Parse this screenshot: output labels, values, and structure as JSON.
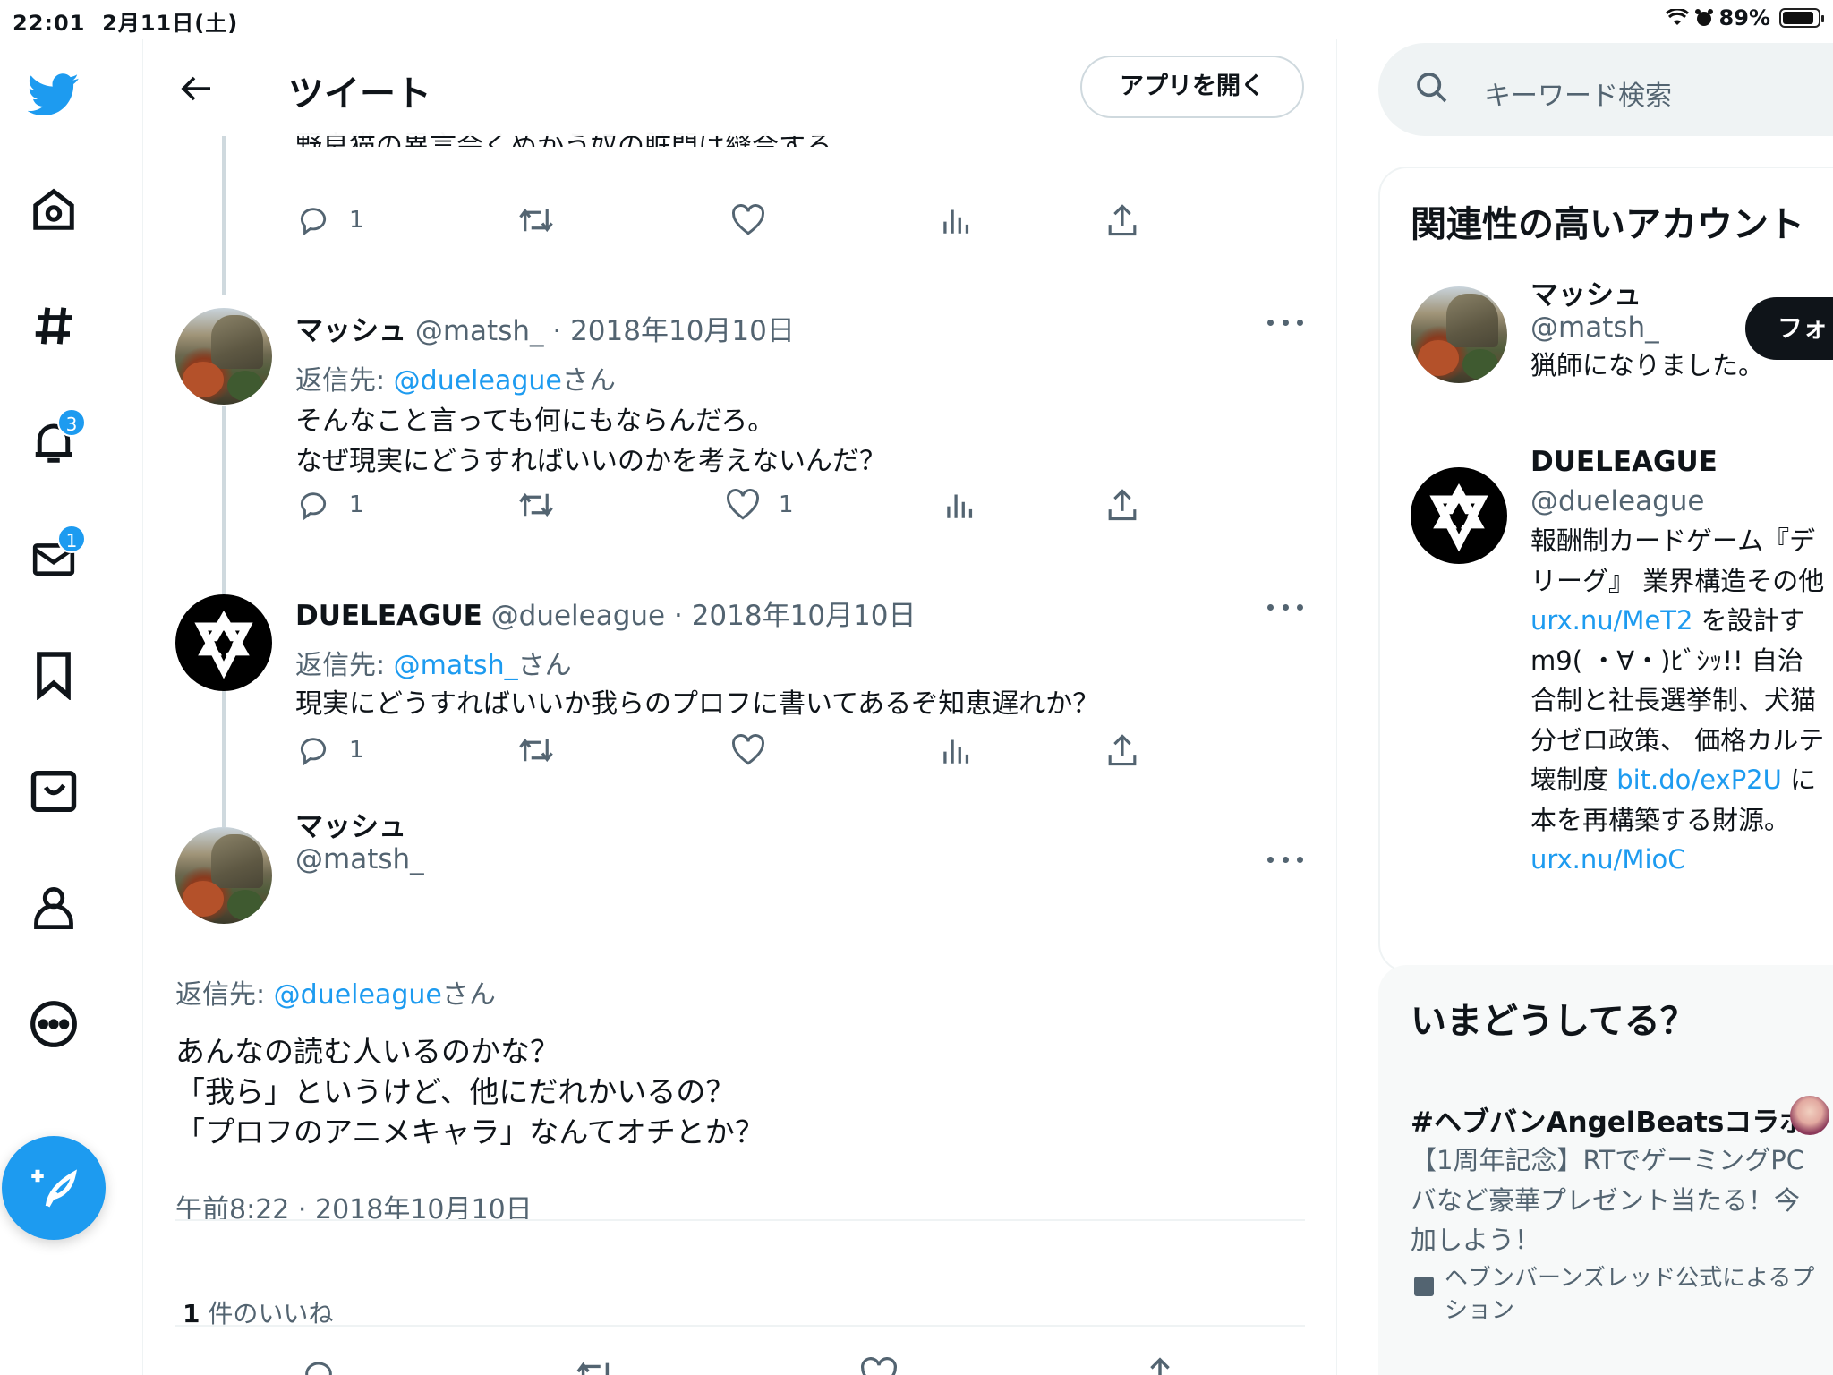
{
  "status_bar": {
    "time": "22:01",
    "date": "2月11日(土)",
    "battery_pct": "89%",
    "battery_level": 0.89
  },
  "header": {
    "title": "ツイート",
    "open_app_label": "アプリを開く"
  },
  "nav": {
    "icons": [
      "twitter-logo",
      "home-icon",
      "hashtag-icon",
      "bell-icon",
      "mail-icon",
      "bookmark-icon",
      "twitter-blue-icon",
      "profile-icon",
      "more-circle-icon"
    ],
    "notifications_badge": "3",
    "messages_badge": "1"
  },
  "clipped_text": "野良猫の異言会くめかう奴の脏門は縫合する。",
  "thread": [
    {
      "actions": {
        "reply": "1",
        "retweet": "",
        "like": ""
      }
    },
    {
      "name": "マッシュ",
      "handle": "@matsh_",
      "date": "2018年10月10日",
      "reply_prefix": "返信先: ",
      "reply_mention": "@dueleague",
      "reply_suffix": "さん",
      "text": "そんなこと言っても何にもならんだろ。\nなぜ現実にどうすればいいのかを考えないんだ？",
      "actions": {
        "reply": "1",
        "retweet": "",
        "like": "1"
      }
    },
    {
      "name": "DUELEAGUE",
      "handle": "@dueleague",
      "date": "2018年10月10日",
      "reply_prefix": "返信先: ",
      "reply_mention": "@matsh_",
      "reply_suffix": "さん",
      "text": "現実にどうすればいいか我らのプロフに書いてあるぞ知恵遅れか？",
      "actions": {
        "reply": "1",
        "retweet": "",
        "like": ""
      }
    }
  ],
  "focus_tweet": {
    "name": "マッシュ",
    "handle": "@matsh_",
    "reply_prefix": "返信先: ",
    "reply_mention": "@dueleague",
    "reply_suffix": "さん",
    "text": "あんなの読む人いるのかな？\n「我ら」というけど、他にだれかいるの？\n「プロフのアニメキャラ」なんてオチとか？",
    "timestamp": "午前8:22 · 2018年10月10日",
    "likes_count": "1",
    "likes_label": " 件のいいね"
  },
  "sidebar": {
    "search_placeholder": "キーワード検索",
    "related_title": "関連性の高いアカウント",
    "accounts": [
      {
        "name": "マッシュ",
        "handle": "@matsh_",
        "bio": "猟師になりました。",
        "follow_label": "フォ"
      },
      {
        "name": "DUELEAGUE",
        "handle": "@dueleague",
        "bio_lines": [
          [
            "報酬制カードゲーム『デ",
            ""
          ],
          [
            "リーグ』 業界構造その他",
            ""
          ],
          [
            "",
            "urx.nu/MeT2",
            " を設計す"
          ],
          [
            "m9( ・∀・)ﾋﾞｼｯ!! 自治",
            ""
          ],
          [
            "合制と社長選挙制、犬猫",
            ""
          ],
          [
            "分ゼロ政策、 価格カルテ",
            ""
          ],
          [
            "壊制度 ",
            "bit.do/exP2U",
            " に"
          ],
          [
            "本を再構築する財源。",
            ""
          ],
          [
            "",
            "urx.nu/MioC",
            ""
          ]
        ]
      }
    ],
    "trends_title": "いまどうしてる？",
    "trend": {
      "tag": "#ヘブバンAngelBeatsコラボ",
      "desc": "【1周年記念】RTでゲーミングPC\nバなど豪華プレゼント当たる！今\n加しよう！",
      "promo": "ヘブンバーンズレッド公式によるプ\nション"
    }
  }
}
